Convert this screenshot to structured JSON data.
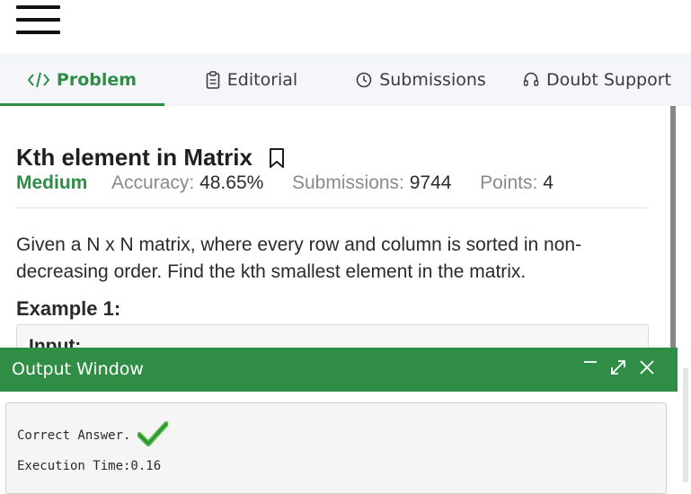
{
  "tabs": [
    {
      "label": "Problem",
      "icon": "code-icon",
      "active": true
    },
    {
      "label": "Editorial",
      "icon": "clipboard-icon",
      "active": false
    },
    {
      "label": "Submissions",
      "icon": "clock-icon",
      "active": false
    },
    {
      "label": "Doubt Support",
      "icon": "headset-icon",
      "active": false
    }
  ],
  "problem": {
    "title": "Kth element in Matrix",
    "difficulty": "Medium",
    "accuracy_label": "Accuracy:",
    "accuracy_value": "48.65%",
    "submissions_label": "Submissions:",
    "submissions_value": "9744",
    "points_label": "Points:",
    "points_value": "4",
    "description": "Given a N x N matrix, where every row and column is sorted in non-decreasing order. Find the kth smallest element in the matrix.",
    "example_heading": "Example 1:",
    "input_label": "Input:"
  },
  "output_window": {
    "title": "Output Window",
    "result_text": "Correct Answer.",
    "execution_text": "Execution Time:0.16"
  },
  "colors": {
    "accent": "#2f8d46"
  }
}
